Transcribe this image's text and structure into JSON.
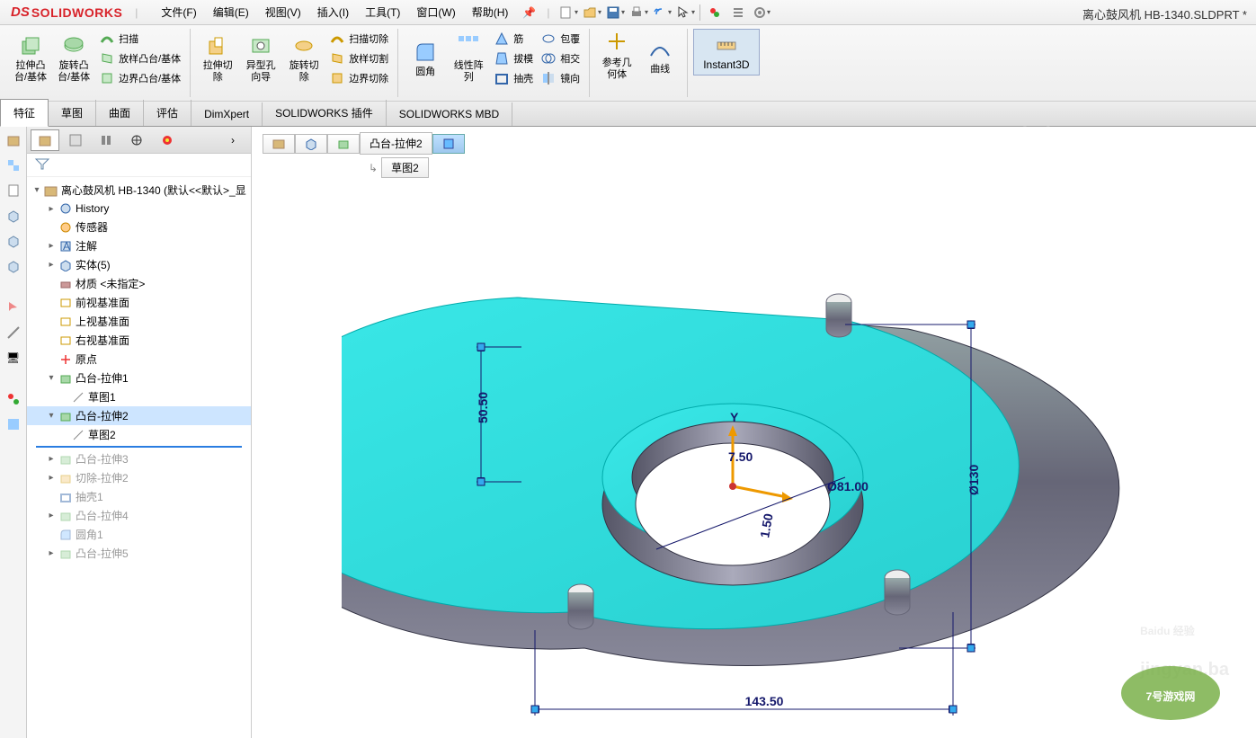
{
  "app": {
    "logo_prefix": "DS",
    "logo_text": "SOLIDWORKS",
    "doc_title": "离心鼓风机 HB-1340.SLDPRT *"
  },
  "menu": {
    "file": "文件(F)",
    "edit": "编辑(E)",
    "view": "视图(V)",
    "insert": "插入(I)",
    "tools": "工具(T)",
    "window": "窗口(W)",
    "help": "帮助(H)"
  },
  "ribbon": {
    "extrude_boss": "拉伸凸\n台/基体",
    "revolve_boss": "旋转凸\n台/基体",
    "sweep": "扫描",
    "loft_boss": "放样凸台/基体",
    "boundary_boss": "边界凸台/基体",
    "extrude_cut": "拉伸切\n除",
    "hole_wizard": "异型孔\n向导",
    "revolve_cut": "旋转切\n除",
    "sweep_cut": "扫描切除",
    "loft_cut": "放样切割",
    "boundary_cut": "边界切除",
    "fillet": "圆角",
    "linear_pattern": "线性阵\n列",
    "rib": "筋",
    "draft": "拔模",
    "shell": "抽壳",
    "wrap": "包覆",
    "intersect": "相交",
    "mirror": "镜向",
    "ref_geom": "参考几\n何体",
    "curves": "曲线",
    "instant3d": "Instant3D"
  },
  "tabs": {
    "feature": "特征",
    "sketch": "草图",
    "surface": "曲面",
    "evaluate": "评估",
    "dimxpert": "DimXpert",
    "sw_addins": "SOLIDWORKS 插件",
    "sw_mbd": "SOLIDWORKS MBD"
  },
  "tree": {
    "root": "离心鼓风机 HB-1340  (默认<<默认>_显",
    "history": "History",
    "sensors": "传感器",
    "annotations": "注解",
    "solid_bodies": "实体(5)",
    "material": "材质 <未指定>",
    "front_plane": "前视基准面",
    "top_plane": "上视基准面",
    "right_plane": "右视基准面",
    "origin": "原点",
    "boss_ext1": "凸台-拉伸1",
    "sketch1": "草图1",
    "boss_ext2": "凸台-拉伸2",
    "sketch2": "草图2",
    "boss_ext3": "凸台-拉伸3",
    "cut_ext2": "切除-拉伸2",
    "shell1": "抽壳1",
    "boss_ext4": "凸台-拉伸4",
    "fillet1": "圆角1",
    "boss_ext5": "凸台-拉伸5"
  },
  "breadcrumb": {
    "item1": "凸台-拉伸2",
    "child": "草图2"
  },
  "dimensions": {
    "d1": "50.50",
    "d2": "143.50",
    "d3": "Ø130",
    "d4": "Ø81.00",
    "d5": "7.50",
    "d6": "1.50",
    "axis_y": "Y"
  },
  "watermark": {
    "baidu": "Baidu 经验",
    "url": "jingyan.ba",
    "game": "7号游戏网"
  }
}
